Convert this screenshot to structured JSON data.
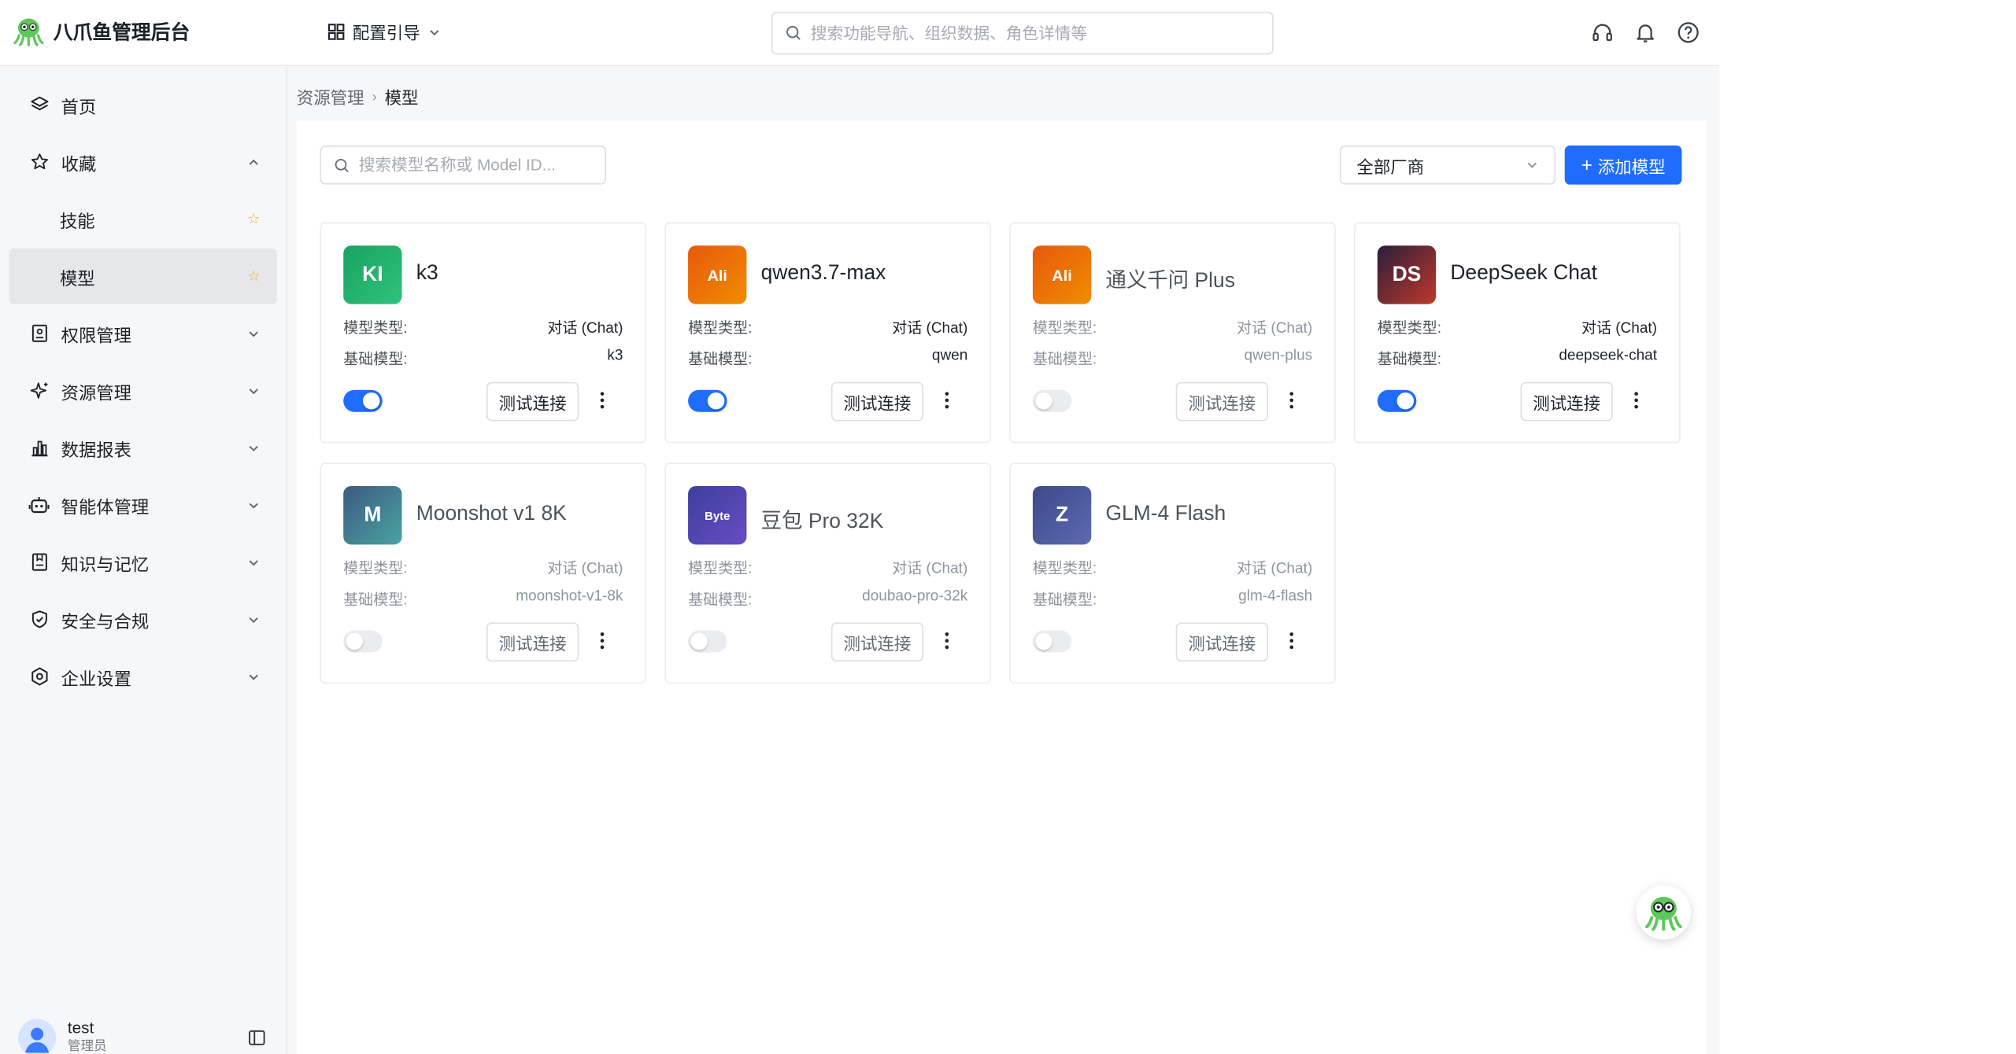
{
  "app": {
    "title": "八爪鱼管理后台"
  },
  "header": {
    "guide_label": "配置引导",
    "search_placeholder": "搜索功能导航、组织数据、角色详情等",
    "icons": [
      "headset-icon",
      "bell-icon",
      "help-icon"
    ]
  },
  "sidebar": {
    "items": [
      {
        "label": "首页",
        "icon": "layers-icon"
      },
      {
        "label": "收藏",
        "icon": "star-icon",
        "expanded": true
      },
      {
        "label": "技能",
        "sub": true,
        "starred": true
      },
      {
        "label": "模型",
        "sub": true,
        "starred": true,
        "active": true
      },
      {
        "label": "权限管理",
        "icon": "id-card-icon"
      },
      {
        "label": "资源管理",
        "icon": "sparkle-icon"
      },
      {
        "label": "数据报表",
        "icon": "bar-chart-icon"
      },
      {
        "label": "智能体管理",
        "icon": "robot-icon"
      },
      {
        "label": "知识与记忆",
        "icon": "book-icon"
      },
      {
        "label": "安全与合规",
        "icon": "shield-icon"
      },
      {
        "label": "企业设置",
        "icon": "settings-icon"
      }
    ],
    "user": {
      "name": "test",
      "role": "管理员"
    }
  },
  "breadcrumb": {
    "parent": "资源管理",
    "current": "模型"
  },
  "toolbar": {
    "search_placeholder": "搜索模型名称或 Model ID...",
    "vendor_select": "全部厂商",
    "add_label": "添加模型"
  },
  "labels": {
    "type_key": "模型类型:",
    "base_key": "基础模型:",
    "test_label": "测试连接"
  },
  "models": [
    {
      "logo": "KI",
      "name": "k3",
      "type": "对话 (Chat)",
      "base": "k3",
      "enabled": true,
      "color": "#1aa260",
      "color2": "#2ec27e"
    },
    {
      "logo": "Ali",
      "name": "qwen3.7-max",
      "type": "对话 (Chat)",
      "base": "qwen",
      "enabled": true,
      "color": "#e8590c",
      "color2": "#f08c00"
    },
    {
      "logo": "Ali",
      "name": "通义千问 Plus",
      "type": "对话 (Chat)",
      "base": "qwen-plus",
      "enabled": false,
      "color": "#e8590c",
      "color2": "#f08c00"
    },
    {
      "logo": "DS",
      "name": "DeepSeek Chat",
      "type": "对话 (Chat)",
      "base": "deepseek-chat",
      "enabled": true,
      "color": "#2b1d3a",
      "color2": "#c0392b"
    },
    {
      "logo": "M",
      "name": "Moonshot v1 8K",
      "type": "对话 (Chat)",
      "base": "moonshot-v1-8k",
      "enabled": false,
      "color": "#3d5a80",
      "color2": "#4aa3a2"
    },
    {
      "logo": "Byte",
      "name": "豆包 Pro 32K",
      "type": "对话 (Chat)",
      "base": "doubao-pro-32k",
      "enabled": false,
      "color": "#3b3f9f",
      "color2": "#6a4cc2"
    },
    {
      "logo": "Z",
      "name": "GLM-4 Flash",
      "type": "对话 (Chat)",
      "base": "glm-4-flash",
      "enabled": false,
      "color": "#3d4a8a",
      "color2": "#5b6bb0"
    }
  ]
}
